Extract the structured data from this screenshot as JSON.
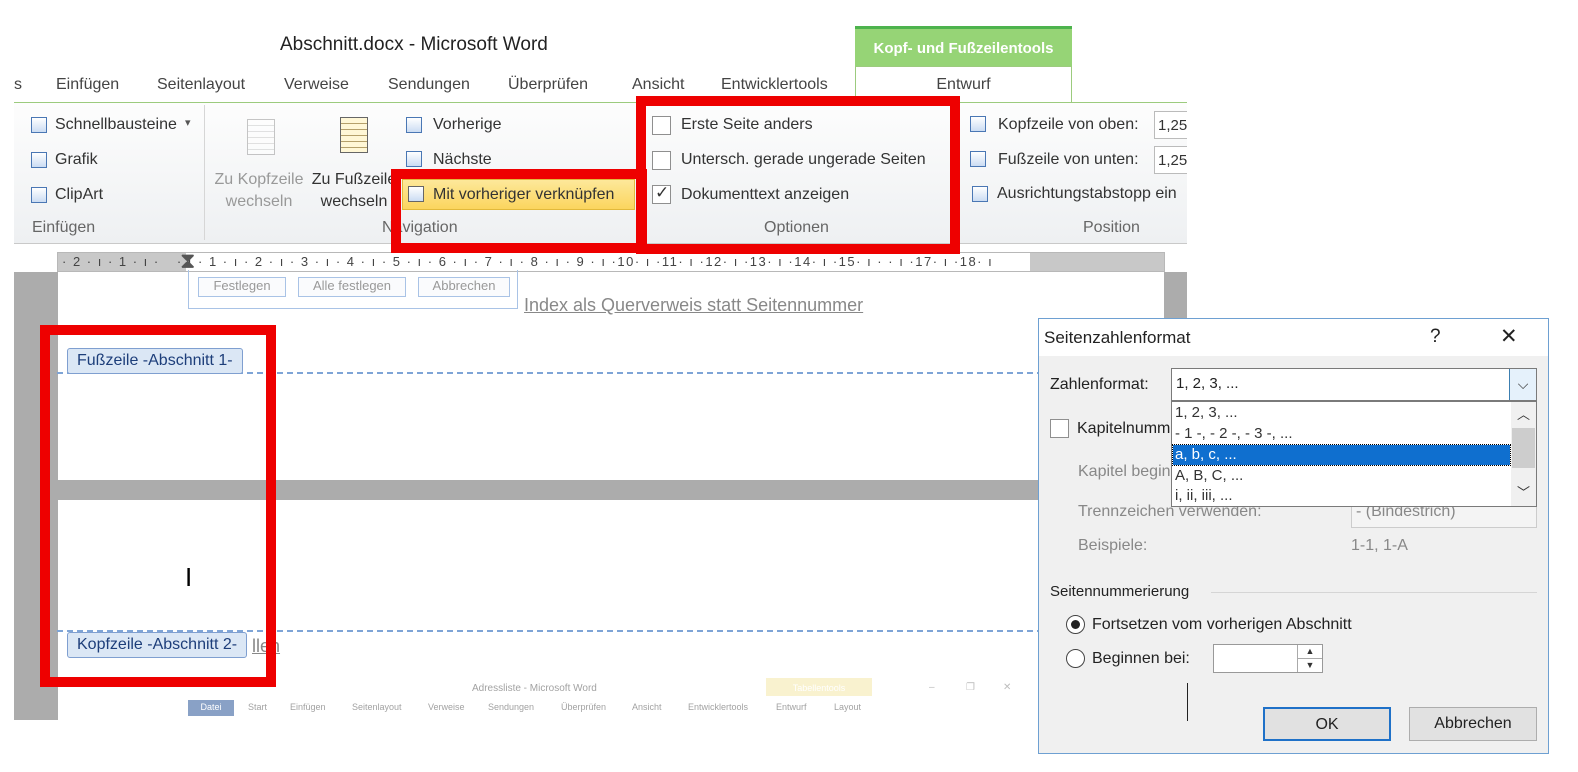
{
  "window": {
    "title": "Abschnitt.docx - Microsoft Word",
    "context_group": "Kopf- und Fußzeilentools"
  },
  "tabs": [
    "s",
    "Einfügen",
    "Seitenlayout",
    "Verweise",
    "Sendungen",
    "Überprüfen",
    "Ansicht",
    "Entwicklertools"
  ],
  "active_tab": "Entwurf",
  "ribbon": {
    "einfuegen": {
      "items": [
        "Schnellbausteine",
        "Grafik",
        "ClipArt"
      ],
      "schnellbausteine_arrow": "▾",
      "group_label": "Einfügen"
    },
    "navigation": {
      "zu_kopfzeile": [
        "Zu Kopfzeile",
        "wechseln"
      ],
      "zu_fusszeile": [
        "Zu Fußzeile",
        "wechseln"
      ],
      "vorherige": "Vorherige",
      "naechste": "Nächste",
      "verknuepfen": "Mit vorheriger verknüpfen",
      "group_label": "Navigation"
    },
    "optionen": {
      "erste_seite": "Erste Seite anders",
      "gerade_ungerade": "Untersch. gerade  ungerade Seiten",
      "dokumenttext": "Dokumenttext anzeigen",
      "erste_seite_checked": false,
      "gerade_ungerade_checked": false,
      "dokumenttext_checked": true,
      "group_label": "Optionen"
    },
    "position": {
      "kopfzeile_label": "Kopfzeile von oben:",
      "kopfzeile_value": "1,25",
      "fusszeile_label": "Fußzeile von unten:",
      "fusszeile_value": "1,25",
      "ausrichtung": "Ausrichtungstabstopp ein",
      "group_label": "Position"
    }
  },
  "ruler": {
    "left": "· 2 · ı · 1 · ı ·",
    "main": "· ı · 1 · ı · 2 · ı · 3 · ı · 4 · ı · 5 · ı · 6 · ı · 7 · ı · 8 · ı · 9 · ı ·10· ı ·11· ı ·12· ı ·13· ı ·14· ı ·15· ı ·",
    "right": "· ı ·17· ı ·18· ı"
  },
  "document": {
    "buttons": [
      "Festlegen",
      "Alle festlegen",
      "Abbrechen"
    ],
    "link_text": "Index als Querverweis statt Seitennummer",
    "footer_tag": "Fußzeile -Abschnitt 1-",
    "header_tag": "Kopfzeile -Abschnitt 2-",
    "partial_link": "llen",
    "cursor": "I",
    "embedded_screenshot": {
      "title": "Adressliste - Microsoft Word",
      "context": "Tabellentools",
      "tabs": [
        "Datei",
        "Start",
        "Einfügen",
        "Seitenlayout",
        "Verweise",
        "Sendungen",
        "Überprüfen",
        "Ansicht",
        "Entwicklertools",
        "Entwurf",
        "Layout"
      ],
      "window_controls": [
        "–",
        "❐",
        "✕"
      ]
    }
  },
  "dialog": {
    "title": "Seitenzahlenformat",
    "help": "?",
    "close": "✕",
    "zahlenformat_label": "Zahlenformat:",
    "zahlenformat_value": "1, 2, 3, ...",
    "options": [
      "1, 2, 3, ...",
      "- 1 -, - 2 -, - 3 -, ...",
      "a, b, c, ...",
      "A, B, C, ...",
      "i, ii, iii, ..."
    ],
    "selected_option": "a, b, c, ...",
    "kapitel_label": "Kapitelnumm",
    "kapitel_beginnt": "Kapitel begin",
    "trennzeichen_label": "Trennzeichen verwenden:",
    "trennzeichen_value": "-    (Bindestrich)",
    "beispiele_label": "Beispiele:",
    "beispiele_value": "1-1, 1-A",
    "section_label": "Seitennummerierung",
    "fortsetzen": "Fortsetzen vom vorherigen Abschnitt",
    "beginnen": "Beginnen bei:",
    "ok": "OK",
    "abbrechen": "Abbrechen"
  },
  "colors": {
    "highlight": "#ee0000",
    "context_tab": "#96d476",
    "selection": "#0f6fcf"
  }
}
